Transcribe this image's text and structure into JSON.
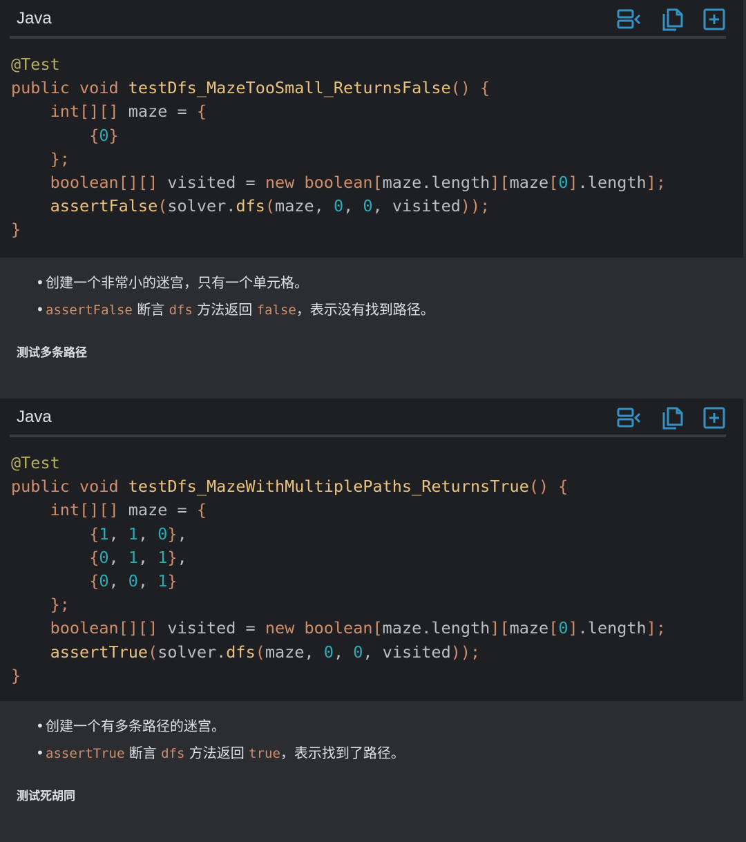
{
  "blocks": [
    {
      "language": "Java",
      "code": [
        [
          [
            "anno",
            "@Test"
          ]
        ],
        [
          [
            "kw",
            "public void "
          ],
          [
            "call",
            "testDfs_MazeTooSmall_ReturnsFalse"
          ],
          [
            "brace",
            "() {"
          ]
        ],
        [
          [
            "plain",
            "    "
          ],
          [
            "kw",
            "int[][] "
          ],
          [
            "plain",
            "maze = "
          ],
          [
            "brace",
            "{"
          ]
        ],
        [
          [
            "plain",
            "        "
          ],
          [
            "brace",
            "{"
          ],
          [
            "num",
            "0"
          ],
          [
            "brace",
            "}"
          ]
        ],
        [
          [
            "plain",
            "    "
          ],
          [
            "brace",
            "};"
          ]
        ],
        [
          [
            "plain",
            "    "
          ],
          [
            "kw",
            "boolean[][] "
          ],
          [
            "plain",
            "visited = "
          ],
          [
            "kw",
            "new boolean"
          ],
          [
            "brace",
            "["
          ],
          [
            "plain",
            "maze.length"
          ],
          [
            "brace",
            "]["
          ],
          [
            "plain",
            "maze"
          ],
          [
            "brace",
            "["
          ],
          [
            "num",
            "0"
          ],
          [
            "brace",
            "]"
          ],
          [
            "plain",
            ".length"
          ],
          [
            "brace",
            "];"
          ]
        ],
        [
          [
            "plain",
            "    "
          ],
          [
            "call",
            "assertFalse"
          ],
          [
            "brace",
            "("
          ],
          [
            "plain",
            "solver."
          ],
          [
            "call",
            "dfs"
          ],
          [
            "brace",
            "("
          ],
          [
            "plain",
            "maze, "
          ],
          [
            "num",
            "0"
          ],
          [
            "plain",
            ", "
          ],
          [
            "num",
            "0"
          ],
          [
            "plain",
            ", visited"
          ],
          [
            "brace",
            "));"
          ]
        ],
        [
          [
            "brace",
            "}"
          ]
        ]
      ]
    },
    {
      "language": "Java",
      "code": [
        [
          [
            "anno",
            "@Test"
          ]
        ],
        [
          [
            "kw",
            "public void "
          ],
          [
            "call",
            "testDfs_MazeWithMultiplePaths_ReturnsTrue"
          ],
          [
            "brace",
            "() {"
          ]
        ],
        [
          [
            "plain",
            "    "
          ],
          [
            "kw",
            "int[][] "
          ],
          [
            "plain",
            "maze = "
          ],
          [
            "brace",
            "{"
          ]
        ],
        [
          [
            "plain",
            "        "
          ],
          [
            "brace",
            "{"
          ],
          [
            "num",
            "1"
          ],
          [
            "plain",
            ", "
          ],
          [
            "num",
            "1"
          ],
          [
            "plain",
            ", "
          ],
          [
            "num",
            "0"
          ],
          [
            "brace",
            "}"
          ],
          [
            "plain",
            ","
          ]
        ],
        [
          [
            "plain",
            "        "
          ],
          [
            "brace",
            "{"
          ],
          [
            "num",
            "0"
          ],
          [
            "plain",
            ", "
          ],
          [
            "num",
            "1"
          ],
          [
            "plain",
            ", "
          ],
          [
            "num",
            "1"
          ],
          [
            "brace",
            "}"
          ],
          [
            "plain",
            ","
          ]
        ],
        [
          [
            "plain",
            "        "
          ],
          [
            "brace",
            "{"
          ],
          [
            "num",
            "0"
          ],
          [
            "plain",
            ", "
          ],
          [
            "num",
            "0"
          ],
          [
            "plain",
            ", "
          ],
          [
            "num",
            "1"
          ],
          [
            "brace",
            "}"
          ]
        ],
        [
          [
            "plain",
            "    "
          ],
          [
            "brace",
            "};"
          ]
        ],
        [
          [
            "plain",
            "    "
          ],
          [
            "kw",
            "boolean[][] "
          ],
          [
            "plain",
            "visited = "
          ],
          [
            "kw",
            "new boolean"
          ],
          [
            "brace",
            "["
          ],
          [
            "plain",
            "maze.length"
          ],
          [
            "brace",
            "]["
          ],
          [
            "plain",
            "maze"
          ],
          [
            "brace",
            "["
          ],
          [
            "num",
            "0"
          ],
          [
            "brace",
            "]"
          ],
          [
            "plain",
            ".length"
          ],
          [
            "brace",
            "];"
          ]
        ],
        [
          [
            "plain",
            "    "
          ],
          [
            "call",
            "assertTrue"
          ],
          [
            "brace",
            "("
          ],
          [
            "plain",
            "solver."
          ],
          [
            "call",
            "dfs"
          ],
          [
            "brace",
            "("
          ],
          [
            "plain",
            "maze, "
          ],
          [
            "num",
            "0"
          ],
          [
            "plain",
            ", "
          ],
          [
            "num",
            "0"
          ],
          [
            "plain",
            ", visited"
          ],
          [
            "brace",
            "));"
          ]
        ],
        [
          [
            "brace",
            "}"
          ]
        ]
      ]
    }
  ],
  "notes1": {
    "b1": "创建一个非常小的迷宫，只有一个单元格。",
    "b2_code1": "assertFalse",
    "b2_t1": " 断言 ",
    "b2_code2": "dfs",
    "b2_t2": " 方法返回 ",
    "b2_code3": "false",
    "b2_t3": "，表示没有找到路径。",
    "heading": "测试多条路径"
  },
  "notes2": {
    "b1": "创建一个有多条路径的迷宫。",
    "b2_code1": "assertTrue",
    "b2_t1": " 断言 ",
    "b2_code2": "dfs",
    "b2_t2": " 方法返回 ",
    "b2_code3": "true",
    "b2_t3": "，表示找到了路径。",
    "heading": "测试死胡同"
  },
  "icons": {
    "insert": "insert-at-caret-icon",
    "copy": "copy-icon",
    "new_file": "new-file-icon",
    "accent": "#3592c4"
  },
  "bullet_char": "•"
}
